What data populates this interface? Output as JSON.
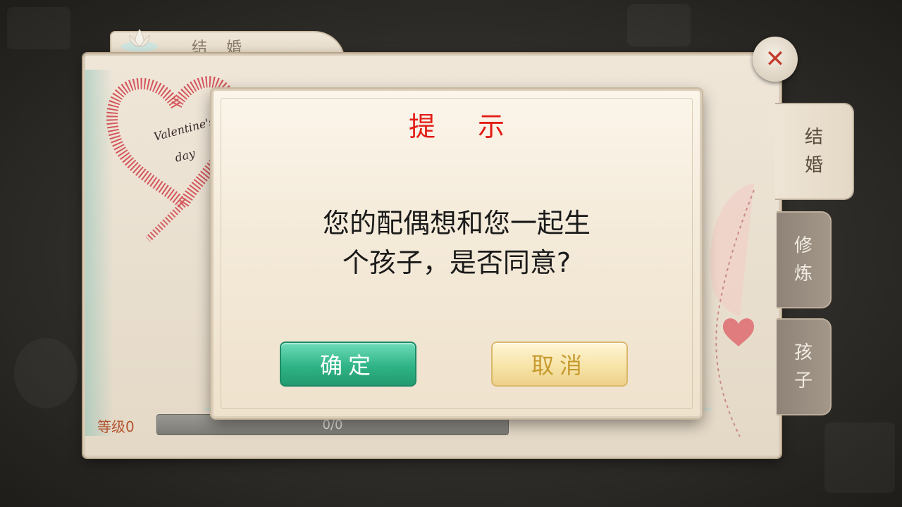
{
  "panel": {
    "title": "结 婚",
    "close_symbol": "✕"
  },
  "side_tabs": [
    {
      "label_line1": "结",
      "label_line2": "婚",
      "active": true
    },
    {
      "label_line1": "修",
      "label_line2": "炼",
      "active": false
    },
    {
      "label_line1": "孩",
      "label_line2": "子",
      "active": false
    }
  ],
  "level": {
    "label": "等级0",
    "progress_text": "0/0",
    "progress": 0
  },
  "dialog": {
    "title": "提示",
    "message_line1": "您的配偶想和您一起生",
    "message_line2": "个孩子，是否同意?",
    "confirm_label": "确定",
    "cancel_label": "取消"
  },
  "colors": {
    "dialog_title": "#e21b14",
    "confirm_button": "#2fb486",
    "cancel_button": "#f7e4a8",
    "level_label": "#b3532f"
  }
}
